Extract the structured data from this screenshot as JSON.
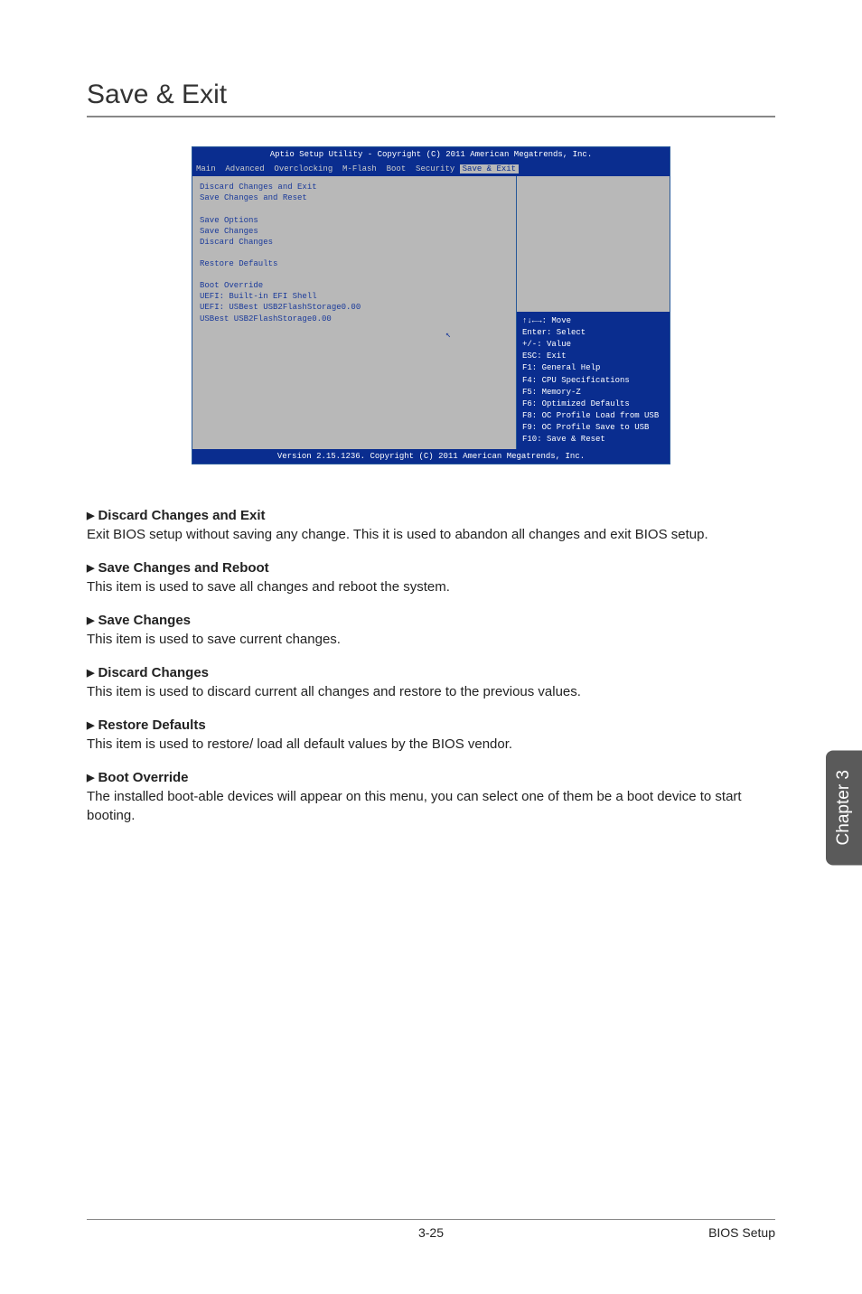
{
  "page": {
    "title": "Save & Exit",
    "pageNumber": "3-25",
    "sectionLabel": "BIOS Setup",
    "sideTab": "Chapter 3"
  },
  "bios": {
    "headerTitle": "Aptio Setup Utility - Copyright (C) 2011 American Megatrends, Inc.",
    "tabs": {
      "prefix": "Main  Advanced  Overclocking  M-Flash  Boot  Security ",
      "active": "Save & Exit"
    },
    "leftItems": {
      "group1": [
        "Discard Changes and Exit",
        "Save Changes and Reset"
      ],
      "group2Header": "Save Options",
      "group2": [
        "Save Changes",
        "Discard Changes"
      ],
      "group3": [
        "Restore Defaults"
      ],
      "group4Header": "Boot Override",
      "group4": [
        "UEFI: Built-in EFI Shell",
        "UEFI: USBest USB2FlashStorage0.00",
        "USBest USB2FlashStorage0.00"
      ]
    },
    "helpKeys": "↑↓←→: Move\nEnter: Select\n+/-: Value\nESC: Exit\nF1: General Help\nF4: CPU Specifications\nF5: Memory-Z\nF6: Optimized Defaults\nF8: OC Profile Load from USB\nF9: OC Profile Save to USB\nF10: Save & Reset",
    "footer": "Version 2.15.1236. Copyright (C) 2011 American Megatrends, Inc."
  },
  "descriptions": [
    {
      "title": "Discard Changes and Exit",
      "body": "Exit BIOS setup without saving any change. This it is used to abandon all changes and exit BIOS setup."
    },
    {
      "title": "Save Changes and Reboot",
      "body": "This item is used to save all changes and reboot the system."
    },
    {
      "title": "Save Changes",
      "body": "This item is used to save current changes."
    },
    {
      "title": "Discard Changes",
      "body": "This item is used to discard current all changes and restore to the previous values."
    },
    {
      "title": "Restore Defaults",
      "body": "This item is used to restore/ load all default values by the BIOS vendor."
    },
    {
      "title": "Boot Override",
      "body": "The installed boot-able devices will appear on this menu, you can select one of them be a boot device to start booting."
    }
  ]
}
